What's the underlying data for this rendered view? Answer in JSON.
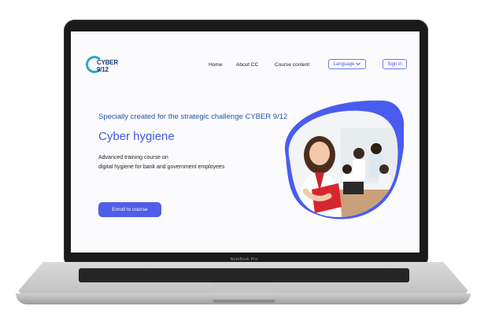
{
  "device": {
    "model": "NoteBook Pro"
  },
  "header": {
    "logo_text": "CYBER 9/12",
    "nav": [
      "Home",
      "About CC",
      "Course content"
    ],
    "language_label": "Language",
    "sign_in_label": "Sign in"
  },
  "hero": {
    "tagline": "Specially created for the strategic challenge CYBER 9/12",
    "title": "Cyber hygiene",
    "description_line1": "Advanced training course on",
    "description_line2": "digital hygiene for bank and government employees",
    "enroll_label": "Enroll to course"
  },
  "colors": {
    "accent": "#4f5ee8",
    "blob": "#4a5cf0",
    "tagline": "#2454a8"
  }
}
